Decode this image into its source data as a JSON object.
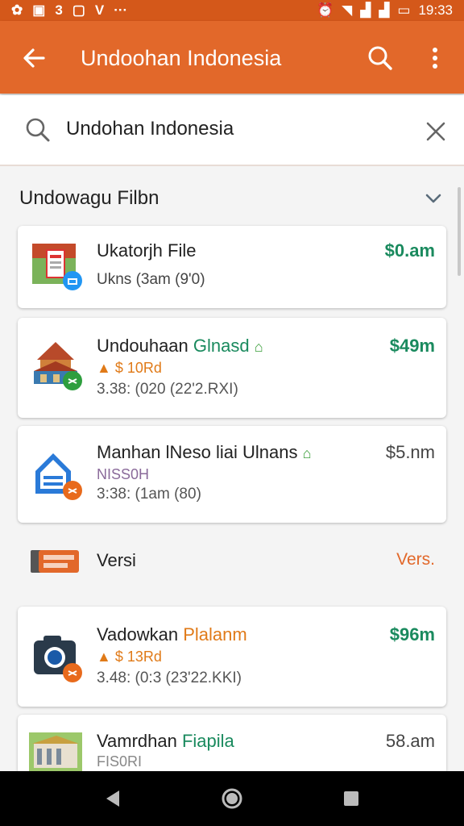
{
  "status": {
    "time": "19:33",
    "left_icons": [
      "app-icon",
      "camera-icon",
      "number-icon",
      "square-icon",
      "v-icon",
      "more-dots-icon"
    ],
    "right_icons": [
      "alarm-icon",
      "wifi-icon",
      "signal-icon",
      "signal-icon",
      "battery-icon"
    ]
  },
  "appbar": {
    "title": "Undoohan Indonesia"
  },
  "search": {
    "value": "Undohan Indonesia"
  },
  "section": {
    "label": "Undowagu Filbn"
  },
  "items": [
    {
      "name": "Ukatorjh File",
      "name_accent": "",
      "sub": "",
      "meta": "Ukns (3am (9'0)",
      "price": "$0.am",
      "badge_color": "#2196f3"
    },
    {
      "name": "Undouhaan ",
      "name_accent": "Glnasd",
      "sub": "$ 10Rd",
      "meta": "3.38: (020 (22'2.RXI)",
      "price": "$49m",
      "badge_color": "#2e9e3e"
    },
    {
      "name": "Manhan lNeso liai Ulnans",
      "name_accent": "",
      "sub": "NISS0H",
      "meta": "3:38: (1am (80)",
      "price": "$5.nm",
      "badge_color": "#e86a1c"
    },
    {
      "name": "Vadowkan ",
      "name_accent": "Plalanm",
      "sub": "$ 13Rd",
      "meta": "3.48: (0:3 (23'22.KKI)",
      "price": "$96m",
      "badge_color": "#e86a1c"
    },
    {
      "name": "Vamrdhan ",
      "name_accent": "Fiapila",
      "sub": "FIS0RI",
      "meta": "",
      "price": "58.am",
      "badge_color": ""
    }
  ],
  "versi": {
    "label": "Versi",
    "right": "Vers."
  },
  "colors": {
    "accent": "#e2682a",
    "price_green": "#1a8a5e",
    "sub_orange": "#e07a18"
  }
}
